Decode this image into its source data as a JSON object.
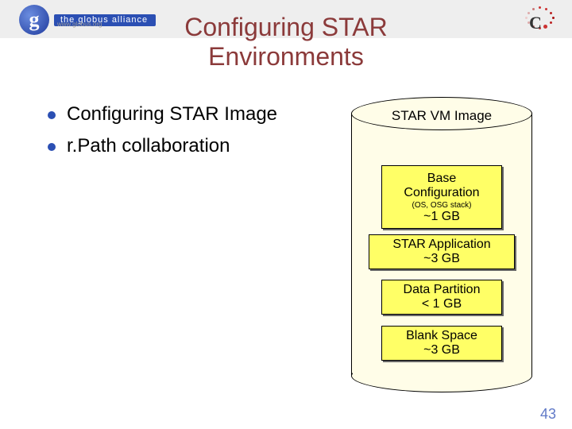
{
  "logos": {
    "globus_text": "the globus alliance",
    "globus_url": "www.globus.org"
  },
  "title": {
    "line1": "Configuring STAR",
    "line2": "Environments"
  },
  "bullets": [
    {
      "text": "Configuring STAR Image"
    },
    {
      "text": "r.Path collaboration"
    }
  ],
  "cylinder": {
    "label": "STAR VM Image",
    "boxes": {
      "base": {
        "line1": "Base",
        "line2": "Configuration",
        "subnote": "(OS, OSG stack)",
        "size": "~1 GB"
      },
      "app": {
        "line1": "STAR Application",
        "size": "~3 GB"
      },
      "datapart": {
        "line1": "Data Partition",
        "size": "< 1 GB"
      },
      "blank": {
        "line1": "Blank Space",
        "size": "~3 GB"
      }
    }
  },
  "slide_number": "43"
}
